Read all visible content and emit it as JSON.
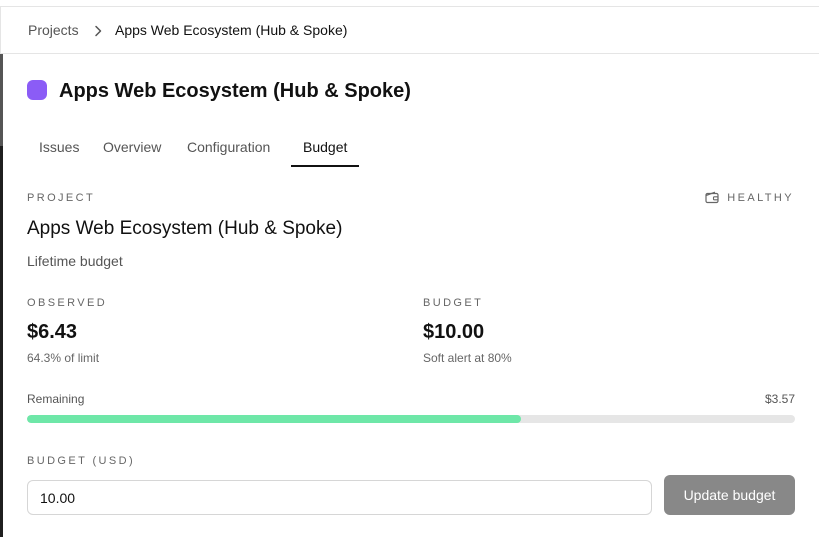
{
  "breadcrumb": {
    "root": "Projects",
    "current": "Apps Web Ecosystem (Hub & Spoke)"
  },
  "header": {
    "title": "Apps Web Ecosystem (Hub & Spoke)",
    "swatch_color": "#8b5cf6"
  },
  "tabs": [
    {
      "label": "Issues",
      "active": false
    },
    {
      "label": "Overview",
      "active": false
    },
    {
      "label": "Configuration",
      "active": false
    },
    {
      "label": "Budget",
      "active": true
    }
  ],
  "budget_panel": {
    "section_label": "PROJECT",
    "status": "HEALTHY",
    "status_icon": "wallet-icon",
    "project_name": "Apps Web Ecosystem (Hub & Spoke)",
    "budget_type": "Lifetime budget",
    "observed": {
      "label": "OBSERVED",
      "value": "$6.43",
      "sub": "64.3% of limit"
    },
    "budget": {
      "label": "BUDGET",
      "value": "$10.00",
      "sub": "Soft alert at 80%"
    },
    "remaining": {
      "label": "Remaining",
      "value": "$3.57"
    },
    "progress": {
      "fraction": 0.643,
      "color": "#6ee7a8"
    },
    "form": {
      "label": "BUDGET (USD)",
      "input_value": "10.00",
      "button_label": "Update budget"
    }
  }
}
